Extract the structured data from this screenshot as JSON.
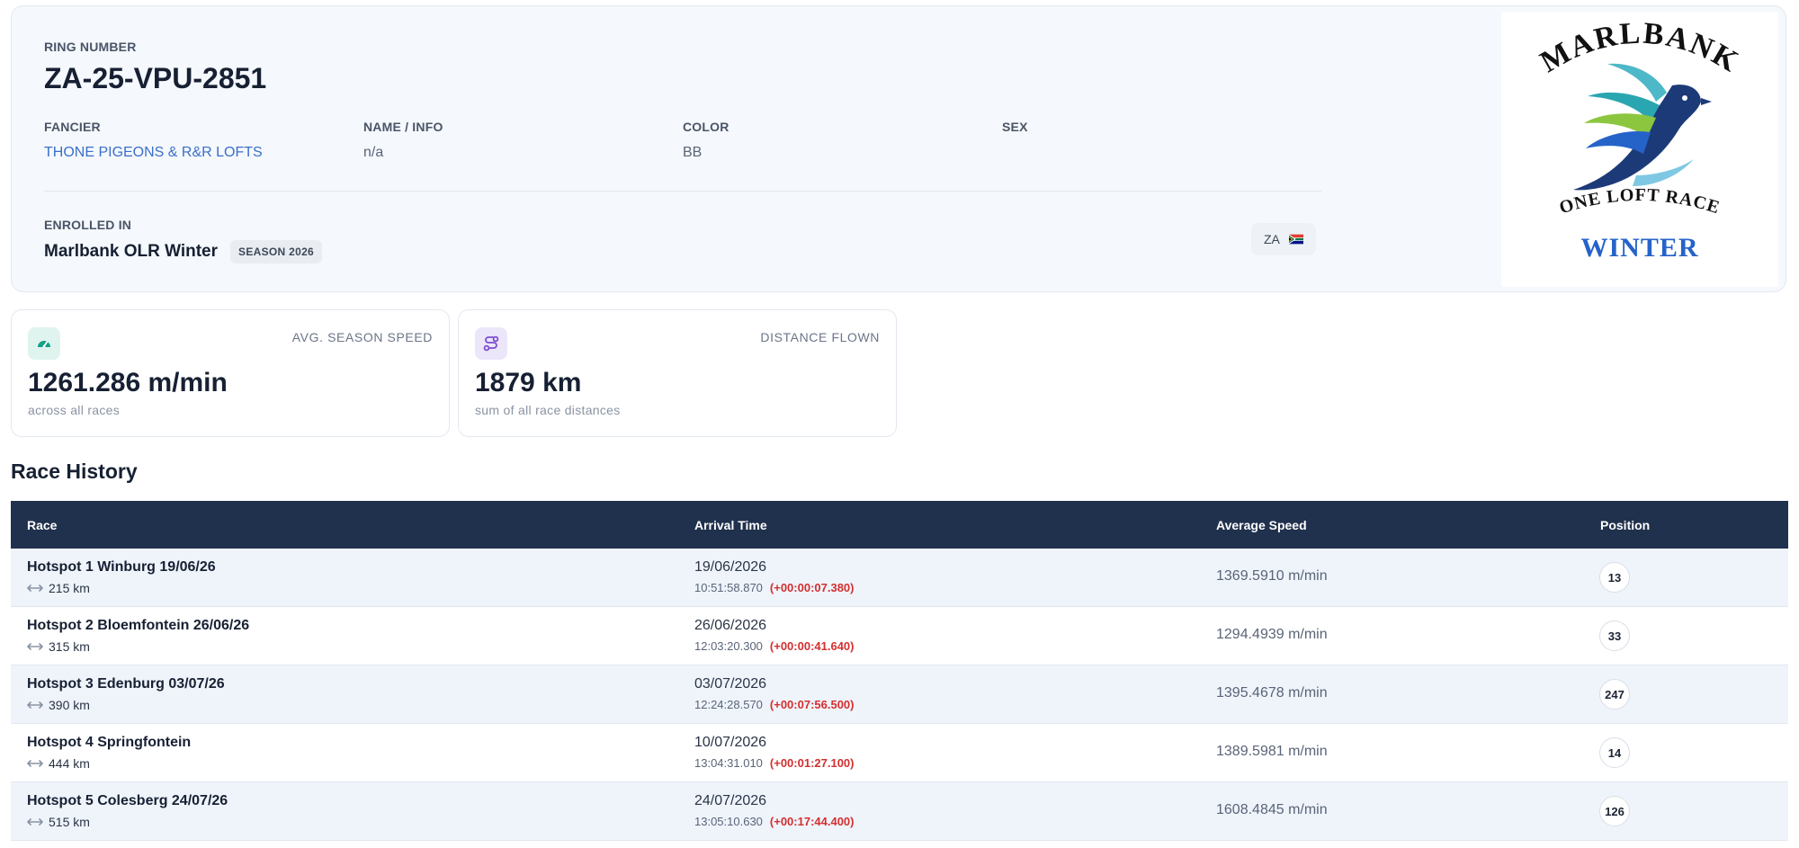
{
  "pigeon": {
    "ring_label": "RING NUMBER",
    "ring_number": "ZA-25-VPU-2851",
    "fancier_label": "FANCIER",
    "fancier": "THONE PIGEONS & R&R LOFTS",
    "name_label": "NAME / INFO",
    "name": "n/a",
    "color_label": "COLOR",
    "color": "BB",
    "sex_label": "SEX",
    "sex": "",
    "enrolled_label": "ENROLLED IN",
    "enrolled_name": "Marlbank OLR Winter",
    "season_badge": "SEASON 2026",
    "country_code": "ZA",
    "country_flag_icon": "south-africa-flag-icon"
  },
  "logo": {
    "top_text": "MARLBANK",
    "middle_text": "ONE LOFT RACE",
    "bottom_text": "WINTER",
    "colors": {
      "navy": "#1d3a78",
      "teal": "#2aa6b0",
      "lime": "#8cc63f",
      "blue": "#2563c9"
    }
  },
  "stats": [
    {
      "title": "AVG. SEASON SPEED",
      "value": "1261.286 m/min",
      "sub": "across all races",
      "icon": "speedometer-icon",
      "icon_bg": "#dff4ef",
      "icon_color": "#16a085"
    },
    {
      "title": "DISTANCE FLOWN",
      "value": "1879 km",
      "sub": "sum of all race distances",
      "icon": "route-icon",
      "icon_bg": "#ece6fb",
      "icon_color": "#7b4fd1"
    }
  ],
  "race_history": {
    "title": "Race History",
    "columns": [
      "Race",
      "Arrival Time",
      "Average Speed",
      "Position"
    ],
    "rows": [
      {
        "race": "Hotspot 1 Winburg 19/06/26",
        "distance": "215 km",
        "date": "19/06/2026",
        "time": "10:51:58.870",
        "diff": "(+00:00:07.380)",
        "speed": "1369.5910 m/min",
        "position": "13"
      },
      {
        "race": "Hotspot 2 Bloemfontein 26/06/26",
        "distance": "315 km",
        "date": "26/06/2026",
        "time": "12:03:20.300",
        "diff": "(+00:00:41.640)",
        "speed": "1294.4939 m/min",
        "position": "33"
      },
      {
        "race": "Hotspot 3 Edenburg 03/07/26",
        "distance": "390 km",
        "date": "03/07/2026",
        "time": "12:24:28.570",
        "diff": "(+00:07:56.500)",
        "speed": "1395.4678 m/min",
        "position": "247"
      },
      {
        "race": "Hotspot 4 Springfontein",
        "distance": "444 km",
        "date": "10/07/2026",
        "time": "13:04:31.010",
        "diff": "(+00:01:27.100)",
        "speed": "1389.5981 m/min",
        "position": "14"
      },
      {
        "race": "Hotspot 5 Colesberg 24/07/26",
        "distance": "515 km",
        "date": "24/07/2026",
        "time": "13:05:10.630",
        "diff": "(+00:17:44.400)",
        "speed": "1608.4845 m/min",
        "position": "126"
      }
    ]
  }
}
